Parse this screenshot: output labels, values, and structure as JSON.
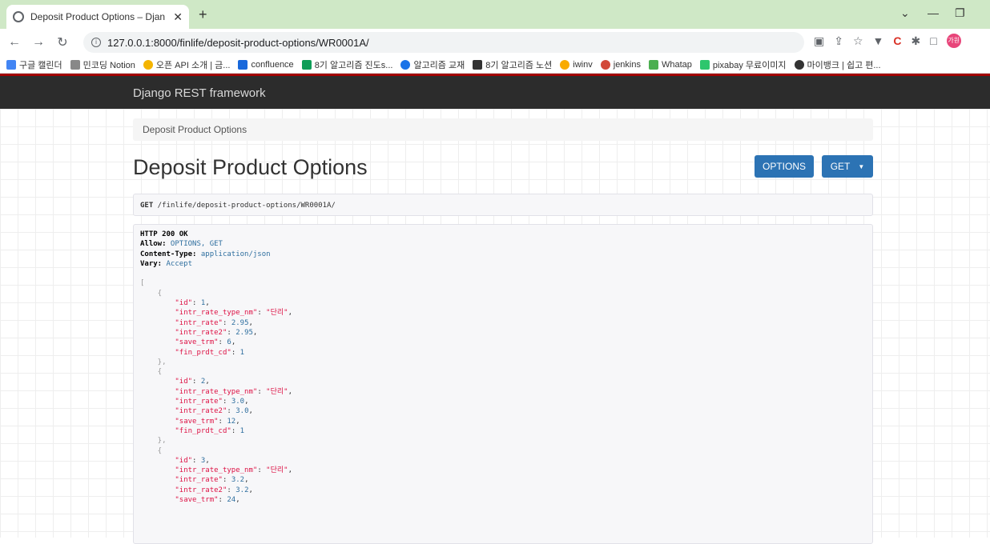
{
  "browser": {
    "tab_title": "Deposit Product Options – Djan",
    "url": "127.0.0.1:8000/finlife/deposit-product-options/WR0001A/",
    "profile_initials": "가원"
  },
  "bookmarks": [
    {
      "label": "구글 캘린더",
      "color": "#4285f4"
    },
    {
      "label": "민코딩 Notion",
      "color": "#888888"
    },
    {
      "label": "오픈 API 소개 | 금...",
      "color": "#f4b400"
    },
    {
      "label": "confluence",
      "color": "#1868db"
    },
    {
      "label": "8기 알고리즘 진도s...",
      "color": "#0f9d58"
    },
    {
      "label": "알고리즘 교재",
      "color": "#1a73e8"
    },
    {
      "label": "8기 알고리즘 노션",
      "color": "#333333"
    },
    {
      "label": "iwinv",
      "color": "#f9ab00"
    },
    {
      "label": "jenkins",
      "color": "#d24939"
    },
    {
      "label": "Whatap",
      "color": "#4caf50"
    },
    {
      "label": "pixabay 무료이미지",
      "color": "#2ec66d"
    },
    {
      "label": "마이뱅크 | 쉽고 편...",
      "color": "#333333"
    }
  ],
  "drf": {
    "brand": "Django REST framework",
    "breadcrumb": "Deposit Product Options",
    "title": "Deposit Product Options",
    "options_label": "OPTIONS",
    "get_label": "GET",
    "request_method": "GET",
    "request_path": " /finlife/deposit-product-options/WR0001A/"
  },
  "response": {
    "status": "HTTP 200 OK",
    "headers": [
      {
        "key": "Allow:",
        "value": " OPTIONS, GET"
      },
      {
        "key": "Content-Type:",
        "value": " application/json"
      },
      {
        "key": "Vary:",
        "value": " Accept"
      }
    ],
    "items": [
      {
        "id": "1",
        "intr_rate_type_nm": "\"단리\"",
        "intr_rate": "2.95",
        "intr_rate2": "2.95",
        "save_trm": "6",
        "fin_prdt_cd": "1"
      },
      {
        "id": "2",
        "intr_rate_type_nm": "\"단리\"",
        "intr_rate": "3.0",
        "intr_rate2": "3.0",
        "save_trm": "12",
        "fin_prdt_cd": "1"
      },
      {
        "id": "3",
        "intr_rate_type_nm": "\"단리\"",
        "intr_rate": "3.2",
        "intr_rate2": "3.2",
        "save_trm": "24"
      }
    ]
  }
}
